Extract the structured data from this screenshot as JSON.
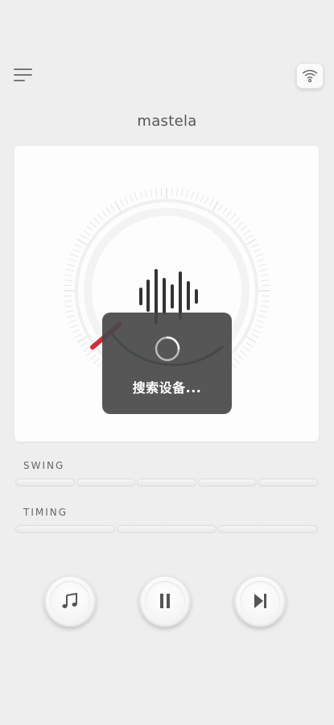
{
  "header": {
    "menu_icon": "hamburger-menu-icon",
    "wifi_icon": "wifi-icon",
    "device_name": "mastela"
  },
  "dial": {
    "icon": "sound-wave-icon"
  },
  "toast": {
    "text": "搜索设备...",
    "icon": "loading-spinner-icon"
  },
  "swing": {
    "label": "SWING",
    "segments": 5
  },
  "timing": {
    "label": "TIMING",
    "segments": 3
  },
  "controls": {
    "music_icon": "music-note-icon",
    "pause_icon": "pause-icon",
    "next_icon": "skip-next-icon"
  },
  "colors": {
    "background": "#eeeeee",
    "card": "#fdfdfd",
    "accent_red": "#d52a3a",
    "accent_teal": "#1f6e6a",
    "toast_bg": "#484848"
  }
}
